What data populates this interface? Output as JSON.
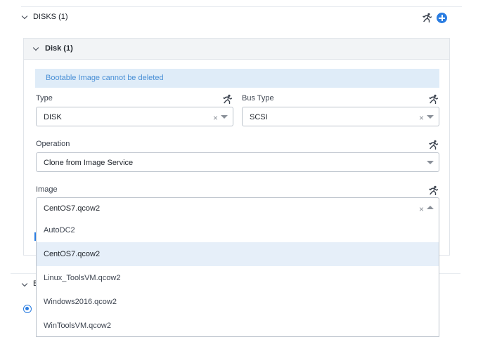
{
  "disks_section": {
    "title": "DISKS (1)",
    "icons": [
      "runner-icon",
      "add-circle-icon"
    ]
  },
  "disk_panel": {
    "title": "Disk (1)",
    "notice": "Bootable Image cannot be deleted",
    "type": {
      "label": "Type",
      "value": "DISK"
    },
    "bus_type": {
      "label": "Bus Type",
      "value": "SCSI"
    },
    "operation": {
      "label": "Operation",
      "value": "Clone from Image Service"
    },
    "image": {
      "label": "Image",
      "value": "CentOS7.qcow2",
      "options": [
        "AutoDC2",
        "CentOS7.qcow2",
        "Linux_ToolsVM.qcow2",
        "Windows2016.qcow2",
        "WinToolsVM.qcow2"
      ],
      "highlighted_option": "CentOS7.qcow2"
    }
  },
  "next_section": {
    "title": "B"
  },
  "colors": {
    "accent": "#2a7de1",
    "notice_bg": "#dfecf8",
    "notice_text": "#4a90d6",
    "highlight_bg": "#e6eff9",
    "panel_header_bg": "#f2f4f6"
  }
}
